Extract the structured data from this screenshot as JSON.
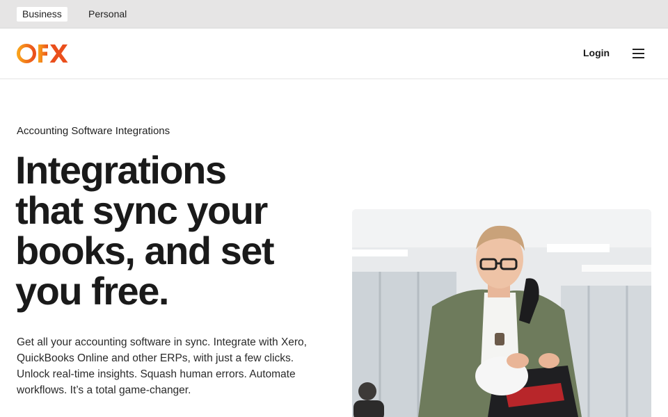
{
  "topbar": {
    "tabs": [
      {
        "label": "Business",
        "active": true
      },
      {
        "label": "Personal",
        "active": false
      }
    ]
  },
  "header": {
    "logo_text": "OFX",
    "login_label": "Login",
    "menu_icon": "hamburger-menu-icon"
  },
  "hero": {
    "eyebrow": "Accounting Software Integrations",
    "headline": [
      "Integrations",
      "that sync your",
      "books, and set",
      "you free."
    ],
    "body": "Get all your accounting software in sync. Integrate with Xero, QuickBooks Online and other ERPs, with just a few clicks. Unlock real-time insights. Squash human errors. Automate workflows. It’s a total game-changer."
  },
  "colors": {
    "brand_orange": "#f7941d",
    "brand_red": "#ea4f1c",
    "topbar_bg": "#e6e5e5"
  }
}
